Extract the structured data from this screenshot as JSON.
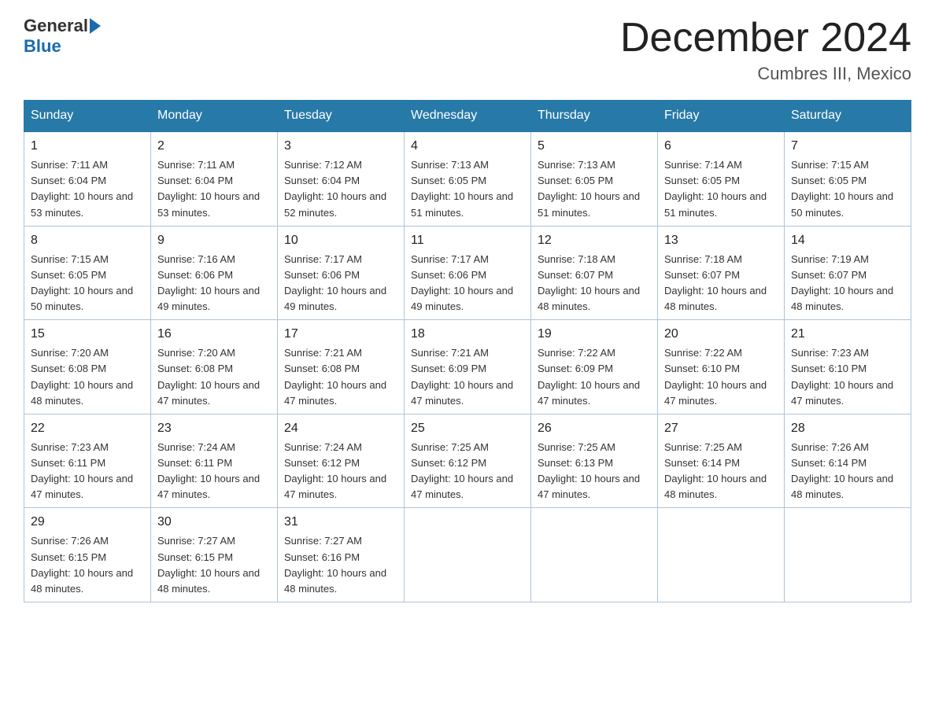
{
  "header": {
    "logo_general": "General",
    "logo_blue": "Blue",
    "month_title": "December 2024",
    "location": "Cumbres III, Mexico"
  },
  "days_of_week": [
    "Sunday",
    "Monday",
    "Tuesday",
    "Wednesday",
    "Thursday",
    "Friday",
    "Saturday"
  ],
  "weeks": [
    [
      {
        "day": "1",
        "sunrise": "7:11 AM",
        "sunset": "6:04 PM",
        "daylight": "10 hours and 53 minutes."
      },
      {
        "day": "2",
        "sunrise": "7:11 AM",
        "sunset": "6:04 PM",
        "daylight": "10 hours and 53 minutes."
      },
      {
        "day": "3",
        "sunrise": "7:12 AM",
        "sunset": "6:04 PM",
        "daylight": "10 hours and 52 minutes."
      },
      {
        "day": "4",
        "sunrise": "7:13 AM",
        "sunset": "6:05 PM",
        "daylight": "10 hours and 51 minutes."
      },
      {
        "day": "5",
        "sunrise": "7:13 AM",
        "sunset": "6:05 PM",
        "daylight": "10 hours and 51 minutes."
      },
      {
        "day": "6",
        "sunrise": "7:14 AM",
        "sunset": "6:05 PM",
        "daylight": "10 hours and 51 minutes."
      },
      {
        "day": "7",
        "sunrise": "7:15 AM",
        "sunset": "6:05 PM",
        "daylight": "10 hours and 50 minutes."
      }
    ],
    [
      {
        "day": "8",
        "sunrise": "7:15 AM",
        "sunset": "6:05 PM",
        "daylight": "10 hours and 50 minutes."
      },
      {
        "day": "9",
        "sunrise": "7:16 AM",
        "sunset": "6:06 PM",
        "daylight": "10 hours and 49 minutes."
      },
      {
        "day": "10",
        "sunrise": "7:17 AM",
        "sunset": "6:06 PM",
        "daylight": "10 hours and 49 minutes."
      },
      {
        "day": "11",
        "sunrise": "7:17 AM",
        "sunset": "6:06 PM",
        "daylight": "10 hours and 49 minutes."
      },
      {
        "day": "12",
        "sunrise": "7:18 AM",
        "sunset": "6:07 PM",
        "daylight": "10 hours and 48 minutes."
      },
      {
        "day": "13",
        "sunrise": "7:18 AM",
        "sunset": "6:07 PM",
        "daylight": "10 hours and 48 minutes."
      },
      {
        "day": "14",
        "sunrise": "7:19 AM",
        "sunset": "6:07 PM",
        "daylight": "10 hours and 48 minutes."
      }
    ],
    [
      {
        "day": "15",
        "sunrise": "7:20 AM",
        "sunset": "6:08 PM",
        "daylight": "10 hours and 48 minutes."
      },
      {
        "day": "16",
        "sunrise": "7:20 AM",
        "sunset": "6:08 PM",
        "daylight": "10 hours and 47 minutes."
      },
      {
        "day": "17",
        "sunrise": "7:21 AM",
        "sunset": "6:08 PM",
        "daylight": "10 hours and 47 minutes."
      },
      {
        "day": "18",
        "sunrise": "7:21 AM",
        "sunset": "6:09 PM",
        "daylight": "10 hours and 47 minutes."
      },
      {
        "day": "19",
        "sunrise": "7:22 AM",
        "sunset": "6:09 PM",
        "daylight": "10 hours and 47 minutes."
      },
      {
        "day": "20",
        "sunrise": "7:22 AM",
        "sunset": "6:10 PM",
        "daylight": "10 hours and 47 minutes."
      },
      {
        "day": "21",
        "sunrise": "7:23 AM",
        "sunset": "6:10 PM",
        "daylight": "10 hours and 47 minutes."
      }
    ],
    [
      {
        "day": "22",
        "sunrise": "7:23 AM",
        "sunset": "6:11 PM",
        "daylight": "10 hours and 47 minutes."
      },
      {
        "day": "23",
        "sunrise": "7:24 AM",
        "sunset": "6:11 PM",
        "daylight": "10 hours and 47 minutes."
      },
      {
        "day": "24",
        "sunrise": "7:24 AM",
        "sunset": "6:12 PM",
        "daylight": "10 hours and 47 minutes."
      },
      {
        "day": "25",
        "sunrise": "7:25 AM",
        "sunset": "6:12 PM",
        "daylight": "10 hours and 47 minutes."
      },
      {
        "day": "26",
        "sunrise": "7:25 AM",
        "sunset": "6:13 PM",
        "daylight": "10 hours and 47 minutes."
      },
      {
        "day": "27",
        "sunrise": "7:25 AM",
        "sunset": "6:14 PM",
        "daylight": "10 hours and 48 minutes."
      },
      {
        "day": "28",
        "sunrise": "7:26 AM",
        "sunset": "6:14 PM",
        "daylight": "10 hours and 48 minutes."
      }
    ],
    [
      {
        "day": "29",
        "sunrise": "7:26 AM",
        "sunset": "6:15 PM",
        "daylight": "10 hours and 48 minutes."
      },
      {
        "day": "30",
        "sunrise": "7:27 AM",
        "sunset": "6:15 PM",
        "daylight": "10 hours and 48 minutes."
      },
      {
        "day": "31",
        "sunrise": "7:27 AM",
        "sunset": "6:16 PM",
        "daylight": "10 hours and 48 minutes."
      },
      null,
      null,
      null,
      null
    ]
  ]
}
